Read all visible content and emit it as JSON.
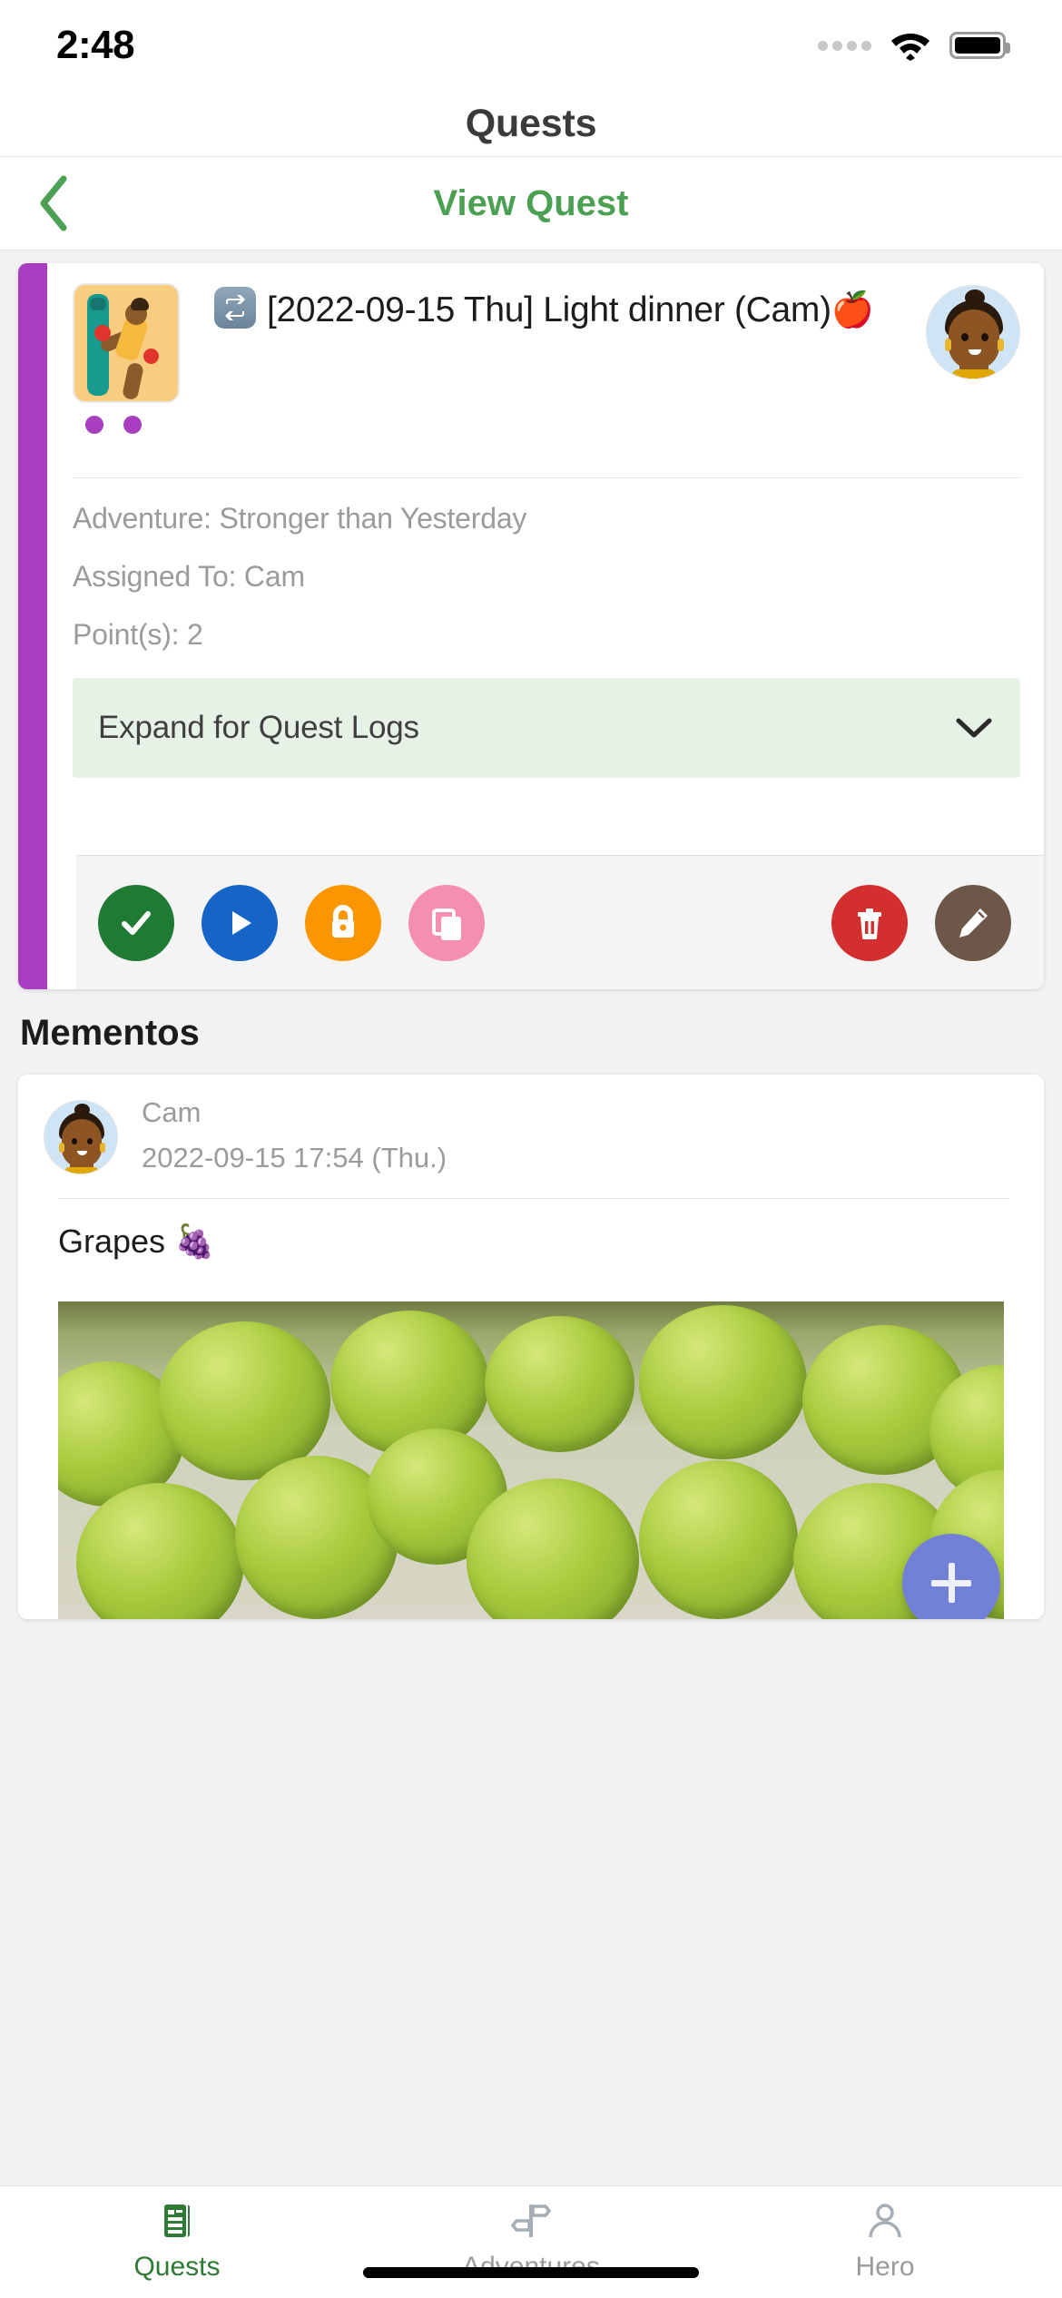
{
  "status_bar": {
    "time": "2:48",
    "signal_icon": "signal-dots-icon",
    "wifi_icon": "wifi-icon",
    "battery_icon": "battery-icon"
  },
  "app": {
    "title": "Quests"
  },
  "subnav": {
    "back_icon": "chevron-left-icon",
    "title": "View Quest",
    "accent_color": "#4ca054"
  },
  "quest": {
    "accent_color": "#a83dc0",
    "thumbnail_icon": "workout-thumbnail-icon",
    "repeat_icon": "repeat-icon",
    "title": "[2022-09-15 Thu] Light dinner (Cam)",
    "title_emoji": "🍎",
    "avatar_icon": "cam-avatar",
    "adventure": "Adventure: Stronger than Yesterday",
    "assigned_to": "Assigned To: Cam",
    "points": "Point(s): 2",
    "expand_label": "Expand for Quest Logs",
    "expand_icon": "chevron-down-icon",
    "actions": [
      {
        "name": "complete-button",
        "icon": "check-icon",
        "color": "#1f7a34"
      },
      {
        "name": "start-button",
        "icon": "play-icon",
        "color": "#1565c8"
      },
      {
        "name": "lock-button",
        "icon": "lock-icon",
        "color": "#fb9600"
      },
      {
        "name": "duplicate-button",
        "icon": "copy-icon",
        "color": "#f58fb2"
      },
      {
        "name": "delete-button",
        "icon": "trash-icon",
        "color": "#d32f2f"
      },
      {
        "name": "edit-button",
        "icon": "pencil-icon",
        "color": "#6d5749"
      }
    ]
  },
  "mementos": {
    "heading": "Mementos",
    "items": [
      {
        "author": "Cam",
        "timestamp": "2022-09-15 17:54 (Thu.)",
        "caption": "Grapes",
        "caption_emoji": "🍇",
        "photo_alt": "green-grapes-photo"
      }
    ]
  },
  "fab": {
    "icon": "plus-icon",
    "color": "#7380d8"
  },
  "tabbar": {
    "items": [
      {
        "label": "Quests",
        "icon": "journal-icon",
        "active": true
      },
      {
        "label": "Adventures",
        "icon": "signpost-icon",
        "active": false
      },
      {
        "label": "Hero",
        "icon": "person-icon",
        "active": false
      }
    ]
  }
}
